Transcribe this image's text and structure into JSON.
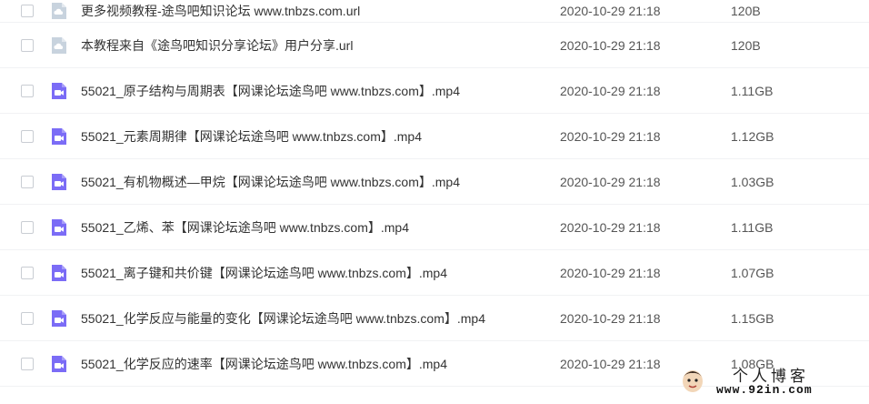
{
  "files": [
    {
      "name": "更多视频教程-途鸟吧知识论坛 www.tnbzs.com.url",
      "date": "2020-10-29 21:18",
      "size": "120B",
      "type": "url"
    },
    {
      "name": "本教程来自《途鸟吧知识分享论坛》用户分享.url",
      "date": "2020-10-29 21:18",
      "size": "120B",
      "type": "url"
    },
    {
      "name": "55021_原子结构与周期表【网课论坛途鸟吧 www.tnbzs.com】.mp4",
      "date": "2020-10-29 21:18",
      "size": "1.11GB",
      "type": "video"
    },
    {
      "name": "55021_元素周期律【网课论坛途鸟吧 www.tnbzs.com】.mp4",
      "date": "2020-10-29 21:18",
      "size": "1.12GB",
      "type": "video"
    },
    {
      "name": "55021_有机物概述—甲烷【网课论坛途鸟吧 www.tnbzs.com】.mp4",
      "date": "2020-10-29 21:18",
      "size": "1.03GB",
      "type": "video"
    },
    {
      "name": "55021_乙烯、苯【网课论坛途鸟吧 www.tnbzs.com】.mp4",
      "date": "2020-10-29 21:18",
      "size": "1.11GB",
      "type": "video"
    },
    {
      "name": "55021_离子键和共价键【网课论坛途鸟吧 www.tnbzs.com】.mp4",
      "date": "2020-10-29 21:18",
      "size": "1.07GB",
      "type": "video"
    },
    {
      "name": "55021_化学反应与能量的变化【网课论坛途鸟吧 www.tnbzs.com】.mp4",
      "date": "2020-10-29 21:18",
      "size": "1.15GB",
      "type": "video"
    },
    {
      "name": "55021_化学反应的速率【网课论坛途鸟吧 www.tnbzs.com】.mp4",
      "date": "2020-10-29 21:18",
      "size": "1.08GB",
      "type": "video"
    }
  ],
  "icons": {
    "url": "cloud-file-icon",
    "video": "video-file-icon"
  },
  "colors": {
    "video_icon": "#7b6cf6",
    "url_icon": "#c8d3de"
  },
  "watermark": {
    "title": "个人博客",
    "site": "www.92in.com"
  }
}
